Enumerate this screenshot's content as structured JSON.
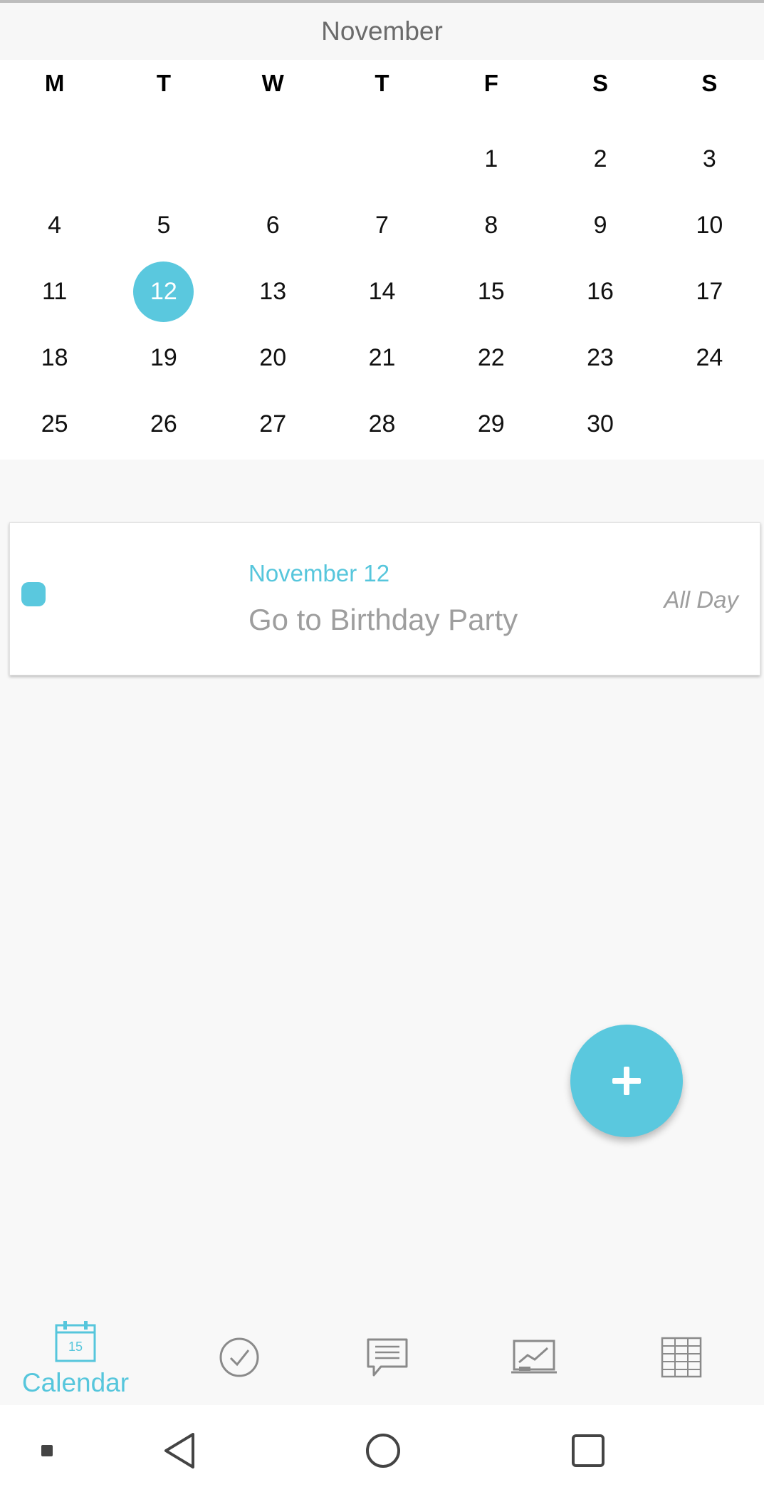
{
  "calendar": {
    "month": "November",
    "weekdays": [
      "M",
      "T",
      "W",
      "T",
      "F",
      "S",
      "S"
    ],
    "weeks": [
      [
        "",
        "",
        "",
        "",
        "1",
        "2",
        "3"
      ],
      [
        "4",
        "5",
        "6",
        "7",
        "8",
        "9",
        "10"
      ],
      [
        "11",
        "12",
        "13",
        "14",
        "15",
        "16",
        "17"
      ],
      [
        "18",
        "19",
        "20",
        "21",
        "22",
        "23",
        "24"
      ],
      [
        "25",
        "26",
        "27",
        "28",
        "29",
        "30",
        ""
      ]
    ],
    "selected_day": "12"
  },
  "event": {
    "date": "November 12",
    "title": "Go to Birthday Party",
    "time": "All Day",
    "color": "#5ac8de"
  },
  "fab": {
    "icon": "plus-icon"
  },
  "bottom_nav": {
    "items": [
      {
        "name": "calendar",
        "label": "Calendar",
        "icon": "calendar-icon",
        "icon_text": "15",
        "active": true
      },
      {
        "name": "tasks",
        "icon": "check-circle-icon"
      },
      {
        "name": "notes",
        "icon": "chat-bubble-icon"
      },
      {
        "name": "stats",
        "icon": "chart-board-icon"
      },
      {
        "name": "table",
        "icon": "grid-table-icon"
      }
    ]
  },
  "system_nav": {
    "items": [
      "menu-dot-icon",
      "back-icon",
      "home-icon",
      "recents-icon"
    ]
  },
  "colors": {
    "accent": "#5ac8de",
    "text_muted": "#9e9e9e"
  }
}
